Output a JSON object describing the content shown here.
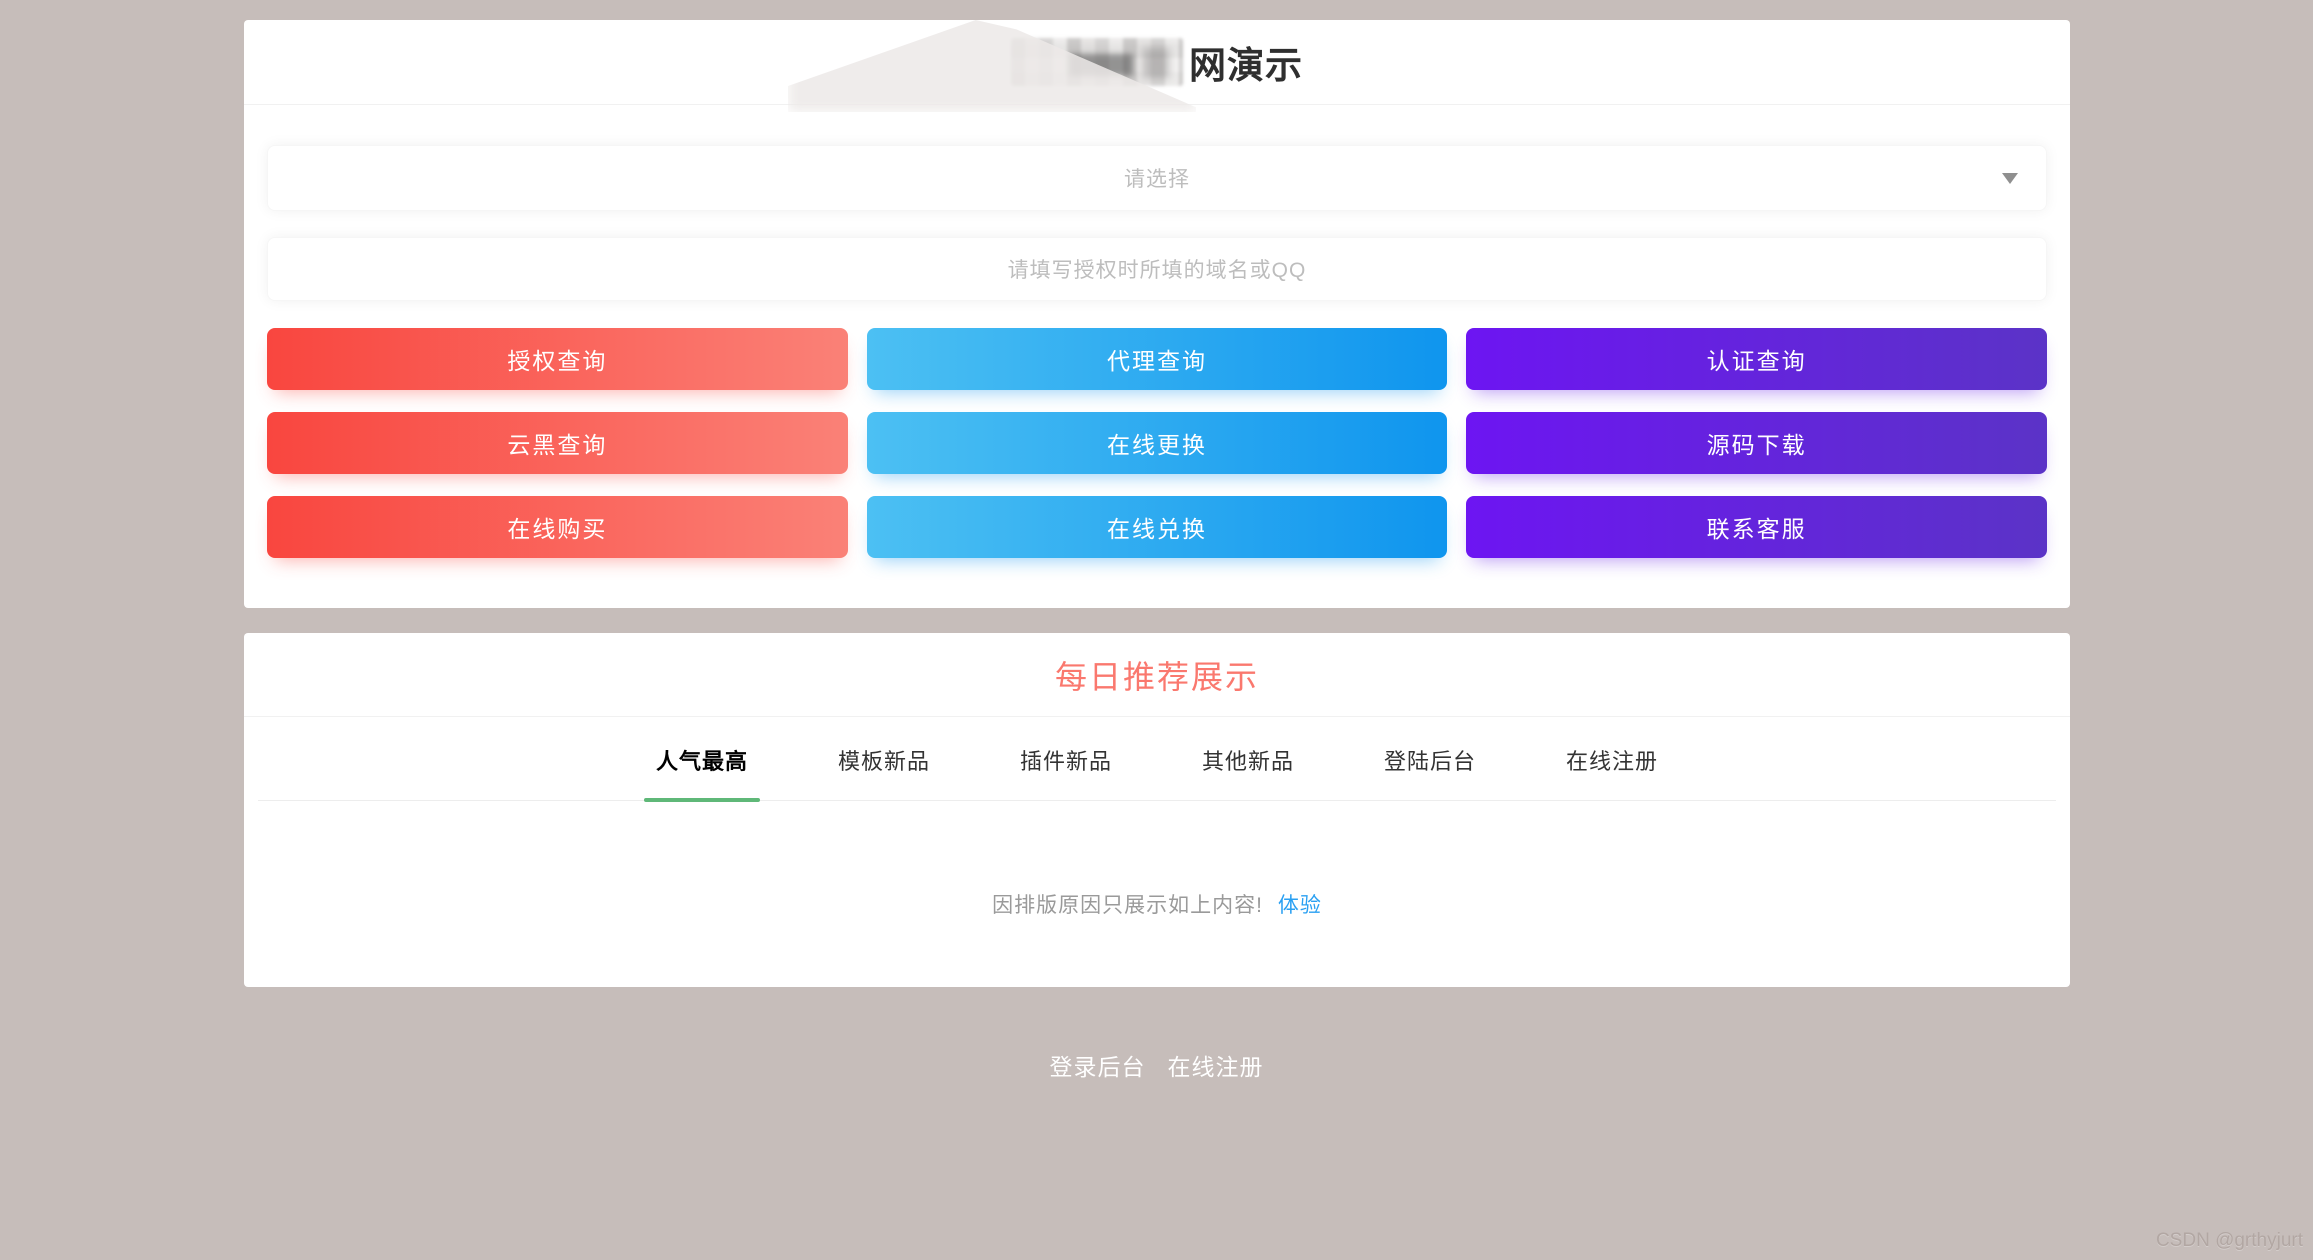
{
  "page": {
    "watermark": "CSDN @grthyjurt"
  },
  "query_card": {
    "title_visible": "网演示",
    "title_redacted": true,
    "select": {
      "placeholder": "请选择"
    },
    "input": {
      "placeholder": "请填写授权时所填的域名或QQ"
    },
    "buttons": [
      {
        "label": "授权查询",
        "color": "red"
      },
      {
        "label": "代理查询",
        "color": "blue"
      },
      {
        "label": "认证查询",
        "color": "purple"
      },
      {
        "label": "云黑查询",
        "color": "red"
      },
      {
        "label": "在线更换",
        "color": "blue"
      },
      {
        "label": "源码下载",
        "color": "purple"
      },
      {
        "label": "在线购买",
        "color": "red"
      },
      {
        "label": "在线兑换",
        "color": "blue"
      },
      {
        "label": "联系客服",
        "color": "purple"
      }
    ]
  },
  "recommend_card": {
    "title": "每日推荐展示",
    "tabs": [
      {
        "label": "人气最高",
        "active": true
      },
      {
        "label": "模板新品",
        "active": false
      },
      {
        "label": "插件新品",
        "active": false
      },
      {
        "label": "其他新品",
        "active": false
      },
      {
        "label": "登陆后台",
        "active": false
      },
      {
        "label": "在线注册",
        "active": false
      }
    ],
    "notice_text": "因排版原因只展示如上内容!",
    "notice_link": "体验"
  },
  "footer": {
    "login_label": "登录后台",
    "register_label": "在线注册"
  },
  "colors": {
    "background": "#c6bdba",
    "card": "#ffffff",
    "button_red_gradient": [
      "#f9463f",
      "#fa8177"
    ],
    "button_blue_gradient": [
      "#4cc0f3",
      "#0f95ee"
    ],
    "button_purple_gradient": [
      "#6d15f2",
      "#5b33c7"
    ],
    "tab_active_underline": "#5FB878",
    "recommend_title": "#fa786e",
    "notice_link_blue": "#2aa0f2"
  }
}
